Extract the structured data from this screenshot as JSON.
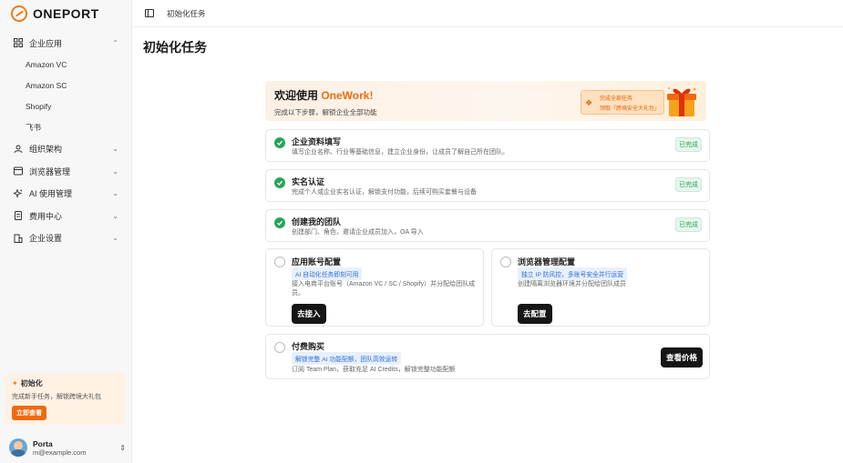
{
  "app": {
    "logo_text": "ONEPORT"
  },
  "sidebar": {
    "items": [
      {
        "label": "企业应用",
        "icon": "apps-icon",
        "chevron": "⌃"
      },
      {
        "label": "组织架构",
        "icon": "org-icon",
        "chevron": "⌄"
      },
      {
        "label": "浏览器管理",
        "icon": "browser-icon",
        "chevron": "⌄"
      },
      {
        "label": "AI 使用管理",
        "icon": "sparkle-icon",
        "chevron": "⌄"
      },
      {
        "label": "费用中心",
        "icon": "bill-icon",
        "chevron": "⌄"
      },
      {
        "label": "企业设置",
        "icon": "building-icon",
        "chevron": "⌄"
      }
    ],
    "subitems": [
      "Amazon VC",
      "Amazon SC",
      "Shopify",
      "飞书"
    ],
    "promo": {
      "title": "初始化",
      "desc": "完成新手任务，解锁跨境大礼包",
      "button": "立即查看"
    },
    "user": {
      "name": "Porta",
      "email": "m@example.com"
    }
  },
  "topbar": {
    "breadcrumb": "初始化任务"
  },
  "page": {
    "title": "初始化任务"
  },
  "banner": {
    "title_prefix": "欢迎使用 ",
    "title_brand": "OneWork!",
    "subtitle": "完成以下步骤，解锁企业全部功能",
    "ribbon_line1": "完成全部任务",
    "ribbon_line2": "领取「跨境安全大礼包」"
  },
  "tasks": {
    "profile": {
      "title": "企业资料填写",
      "desc": "填写企业名称、行业等基础信息，建立企业身份，让成员了解自己所在团队。",
      "status": "已完成"
    },
    "verify": {
      "title": "实名认证",
      "desc": "完成个人或企业实名认证，解锁支付功能，后续可购买套餐与设备",
      "status": "已完成"
    },
    "team": {
      "title": "创建我的团队",
      "desc": "创建部门、角色，邀请企业成员加入，OA 导入",
      "status": "已完成"
    },
    "account": {
      "title": "应用账号配置",
      "tag": "AI 自动化任务即刻可用",
      "desc": "接入电商平台账号（Amazon VC / SC / Shopify）并分配给团队成员。",
      "button": "去接入"
    },
    "browser": {
      "title": "浏览器管理配置",
      "tag": "独立 IP 防风控，多账号安全并行运营",
      "desc": "创建隔离浏览器环境并分配给团队成员",
      "button": "去配置"
    },
    "purchase": {
      "title": "付费购买",
      "tag": "解锁完整 AI 功能配额，团队高效运转",
      "desc": "订阅 Team Plan，获取充足 AI Credits，解锁完整功能配额",
      "button": "查看价格"
    }
  },
  "colors": {
    "accent": "#f06a10",
    "success": "#2aa35a",
    "tag_blue": "#2f6fd8"
  }
}
